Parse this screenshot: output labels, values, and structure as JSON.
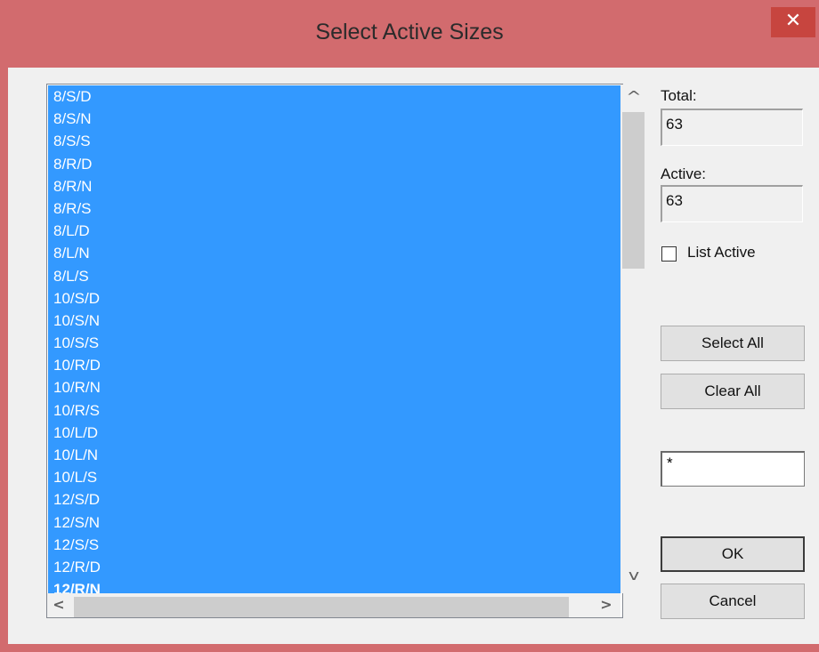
{
  "window": {
    "title": "Select Active Sizes",
    "close_glyph": "✕"
  },
  "list": {
    "items": [
      "8/S/D",
      "8/S/N",
      "8/S/S",
      "8/R/D",
      "8/R/N",
      "8/R/S",
      "8/L/D",
      "8/L/N",
      "8/L/S",
      "10/S/D",
      "10/S/N",
      "10/S/S",
      "10/R/D",
      "10/R/N",
      "10/R/S",
      "10/L/D",
      "10/L/N",
      "10/L/S",
      "12/S/D",
      "12/S/N",
      "12/S/S",
      "12/R/D",
      "12/R/N"
    ],
    "selection_color": "#3399ff"
  },
  "scrollbars": {
    "up_glyph": "^",
    "down_glyph": "v",
    "left_glyph": "<",
    "right_glyph": ">"
  },
  "side": {
    "total_label": "Total:",
    "total_value": "63",
    "active_label": "Active:",
    "active_value": "63",
    "list_active_label": "List Active",
    "list_active_checked": false,
    "select_all_label": "Select All",
    "clear_all_label": "Clear All",
    "filter_value": "*",
    "ok_label": "OK",
    "cancel_label": "Cancel"
  },
  "colors": {
    "titlebar": "#d26b6e",
    "close_button": "#c7453f",
    "client": "#f0f0f0"
  }
}
